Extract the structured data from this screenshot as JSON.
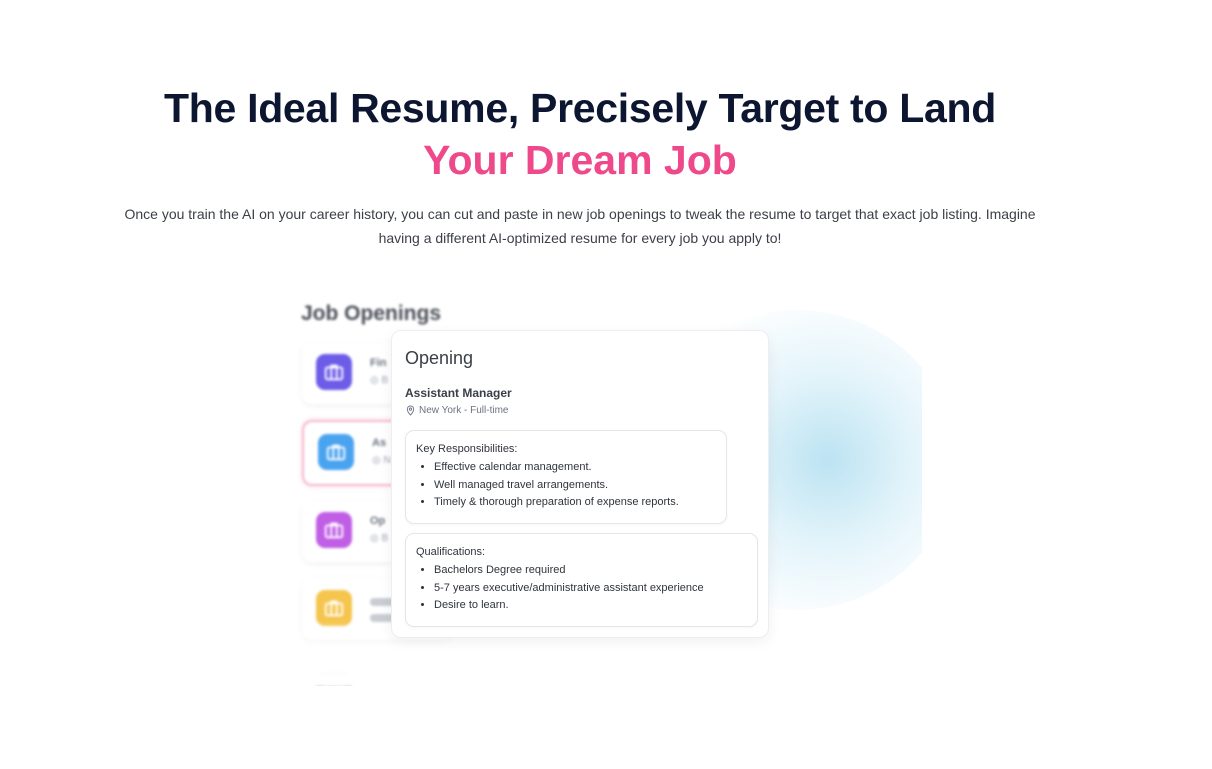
{
  "hero": {
    "headline": "The Ideal Resume, Precisely Target to Land",
    "headline_accent": "Your Dream Job",
    "subcopy": "Once you train the AI on your career history, you can cut and paste in new job openings to tweak the resume to target that exact job listing. Imagine having a different AI-optimized resume for every job you apply to!"
  },
  "colors": {
    "accent": "#ee4a8b",
    "heading": "#0d1630"
  },
  "job_list": {
    "title": "Job Openings",
    "items": [
      {
        "label": "Fin",
        "sub": "◎ B",
        "icon": "briefcase-icon",
        "color": "#6d5ce8"
      },
      {
        "label": "As",
        "sub": "◎ N",
        "icon": "briefcase-icon",
        "color": "#4aa3f0"
      },
      {
        "label": "Op",
        "sub": "◎ B",
        "icon": "briefcase-icon",
        "color": "#c15ee6"
      },
      {
        "label": "",
        "sub": "",
        "icon": "briefcase-icon",
        "color": "#f5c54e"
      },
      {
        "label": "",
        "sub": "",
        "icon": "briefcase-icon",
        "color": "#c7c9cd"
      }
    ]
  },
  "opening": {
    "title": "Opening",
    "role": "Assistant Manager",
    "location": "New York - Full-time",
    "responsibilities": {
      "heading": "Key Responsibilities:",
      "items": [
        "Effective calendar management.",
        "Well managed travel arrangements.",
        "Timely & thorough preparation of expense reports."
      ]
    },
    "qualifications": {
      "heading": "Qualifications:",
      "items": [
        "Bachelors Degree required",
        "5-7 years executive/administrative assistant experience",
        "Desire to learn."
      ]
    }
  }
}
